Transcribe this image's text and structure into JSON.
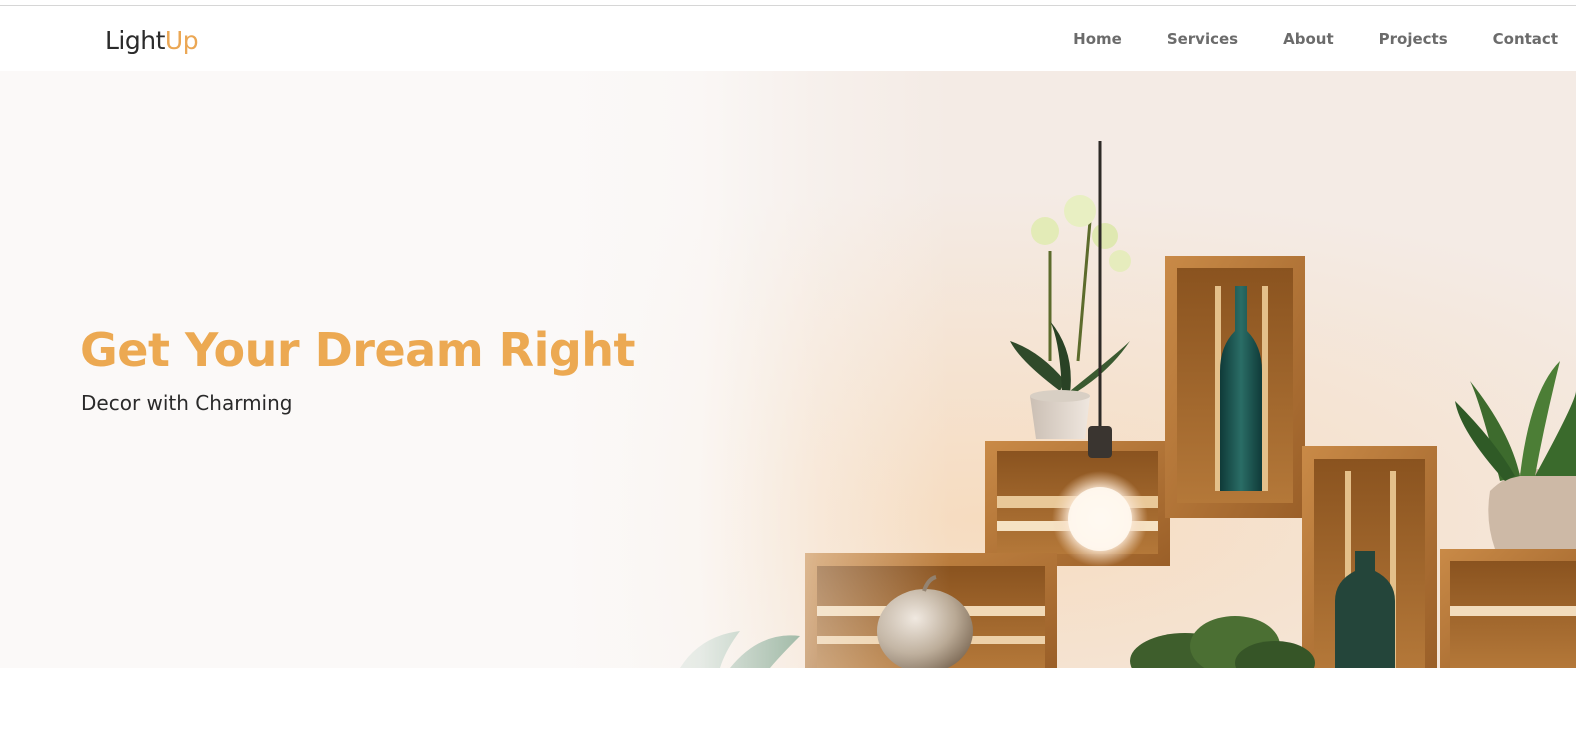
{
  "brand": {
    "name_part1": "Light",
    "name_part2": "Up",
    "accent_color": "#eca952"
  },
  "nav": {
    "items": [
      {
        "label": "Home"
      },
      {
        "label": "Services"
      },
      {
        "label": "About"
      },
      {
        "label": "Projects"
      },
      {
        "label": "Contact"
      }
    ]
  },
  "hero": {
    "title": "Get Your Dream Right",
    "subtitle": "Decor with Charming",
    "image_subject": "wooden-crate-shelves-with-plants-bottles-and-pendant-bulb"
  }
}
